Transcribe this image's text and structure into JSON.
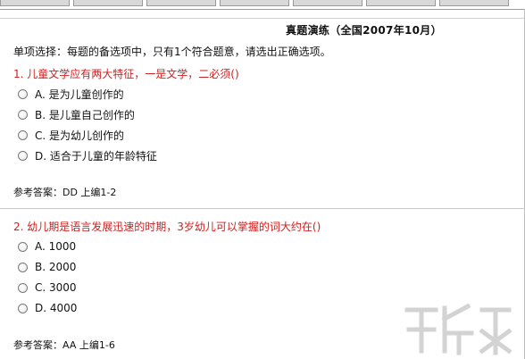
{
  "title": "真题演练（全国2007年10月）",
  "instructions": "单项选择：每题的备选项中，只有1个符合题意，请选出正确选项。",
  "questions": [
    {
      "text": "1. 儿童文学应有两大特征，一是文学，二必须()",
      "options": [
        "A. 是为儿童创作的",
        "B. 是儿童自己创作的",
        "C. 是为幼儿创作的",
        "D. 适合于儿童的年龄特征"
      ],
      "answer": "参考答案：DD 上编1-2"
    },
    {
      "text": "2. 幼儿期是语言发展迅速的时期，3岁幼儿可以掌握的词大约在()",
      "options": [
        "A. 1000",
        "B. 2000",
        "C. 3000",
        "D. 4000"
      ],
      "answer": "参考答案：AA 上编1-6"
    }
  ],
  "colors": {
    "question_text": "#d02020",
    "body_text": "#111111",
    "tab_bg": "#d9d9d9",
    "divider": "#9a9a9a"
  },
  "icons": {
    "watermark": "download-site-logo-icon"
  }
}
